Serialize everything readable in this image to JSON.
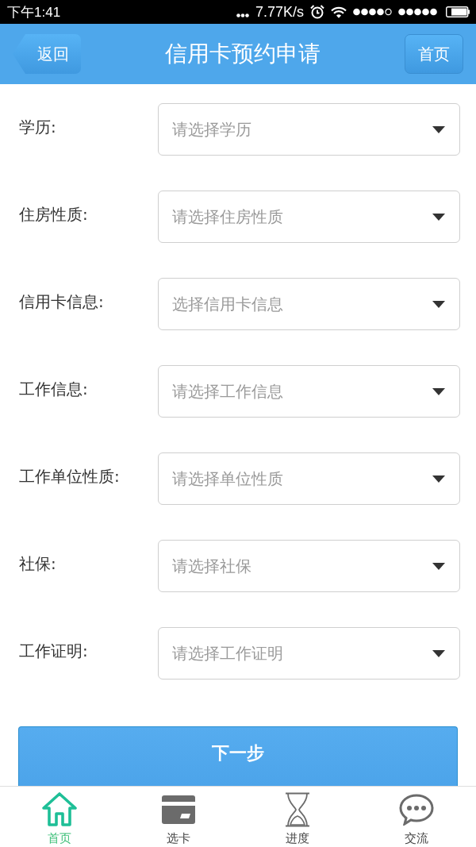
{
  "status_bar": {
    "time": "下午1:41",
    "network_speed": "7.77K/s"
  },
  "nav_bar": {
    "back_button": "返回",
    "title": "信用卡预约申请",
    "home_button": "首页"
  },
  "form": {
    "fields": [
      {
        "label": "学历:",
        "placeholder": "请选择学历"
      },
      {
        "label": "住房性质:",
        "placeholder": "请选择住房性质"
      },
      {
        "label": "信用卡信息:",
        "placeholder": "选择信用卡信息"
      },
      {
        "label": "工作信息:",
        "placeholder": "请选择工作信息"
      },
      {
        "label": "工作单位性质:",
        "placeholder": "请选择单位性质"
      },
      {
        "label": "社保:",
        "placeholder": "请选择社保"
      },
      {
        "label": "工作证明:",
        "placeholder": "请选择工作证明"
      }
    ]
  },
  "submit_button": "下一步",
  "tab_bar": [
    {
      "label": "首页",
      "selected": true
    },
    {
      "label": "选卡",
      "selected": false
    },
    {
      "label": "进度",
      "selected": false
    },
    {
      "label": "交流",
      "selected": false
    }
  ]
}
